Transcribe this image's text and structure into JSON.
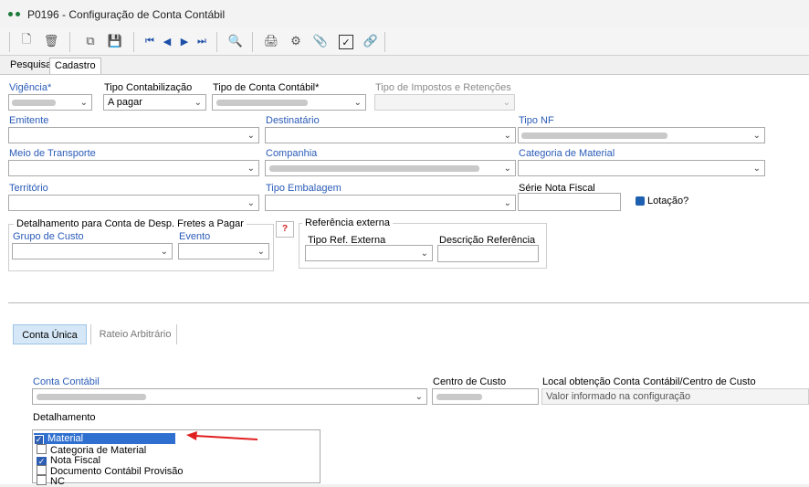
{
  "window": {
    "title": "P0196 - Configuração de Conta Contábil"
  },
  "toolbar": {
    "icons": [
      "new-document-icon",
      "delete-icon",
      "copy-icon",
      "save-icon",
      "first-record-icon",
      "previous-record-icon",
      "next-record-icon",
      "last-record-icon",
      "search-record-icon",
      "print-icon",
      "settings-icon",
      "attach-icon",
      "checkbox-icon",
      "link-icon"
    ]
  },
  "tabs": [
    "Pesquisa",
    "Cadastro"
  ],
  "form": {
    "vigencia_label": "Vigência*",
    "tipo_contab_label": "Tipo Contabilização",
    "tipo_contab_value": "A pagar",
    "tipo_conta_label": "Tipo de Conta Contábil*",
    "tipo_impostos_label": "Tipo de Impostos e Retenções",
    "emitente_label": "Emitente",
    "destinatario_label": "Destinatário",
    "tipo_nf_label": "Tipo NF",
    "meio_transporte_label": "Meio de Transporte",
    "companhia_label": "Companhia",
    "categoria_material_label": "Categoria de Material",
    "territorio_label": "Território",
    "tipo_embalagem_label": "Tipo Embalagem",
    "serie_nf_label": "Série Nota Fiscal",
    "lotacao_label": "Lotação?",
    "detalhamento_group_title": "Detalhamento para Conta de Desp. Fretes a Pagar",
    "grupo_custo_label": "Grupo de Custo",
    "evento_label": "Evento",
    "help_button": "?",
    "referencia_group_title": "Referência externa",
    "tipo_ref_label": "Tipo Ref. Externa",
    "descricao_ref_label": "Descrição Referência"
  },
  "lower": {
    "seg_tabs": [
      "Conta Única",
      "Rateio Arbitrário"
    ],
    "conta_contabil_label": "Conta Contábil",
    "centro_custo_label": "Centro de Custo",
    "local_obtencao_label": "Local obtenção Conta Contábil/Centro de Custo",
    "local_obtencao_value": "Valor informado na configuração",
    "detalhamento_label": "Detalhamento",
    "detalhamento_items": [
      {
        "label": "Material",
        "checked": true,
        "selected": true
      },
      {
        "label": "Categoria de Material",
        "checked": false,
        "selected": false
      },
      {
        "label": "Nota Fiscal",
        "checked": true,
        "selected": false
      },
      {
        "label": "Documento Contábil Provisão",
        "checked": false,
        "selected": false
      },
      {
        "label": "NC",
        "checked": false,
        "selected": false
      }
    ]
  },
  "colors": {
    "accent": "#2a5bb8",
    "arrow": "#e02020",
    "selection": "#2f6fd0"
  }
}
